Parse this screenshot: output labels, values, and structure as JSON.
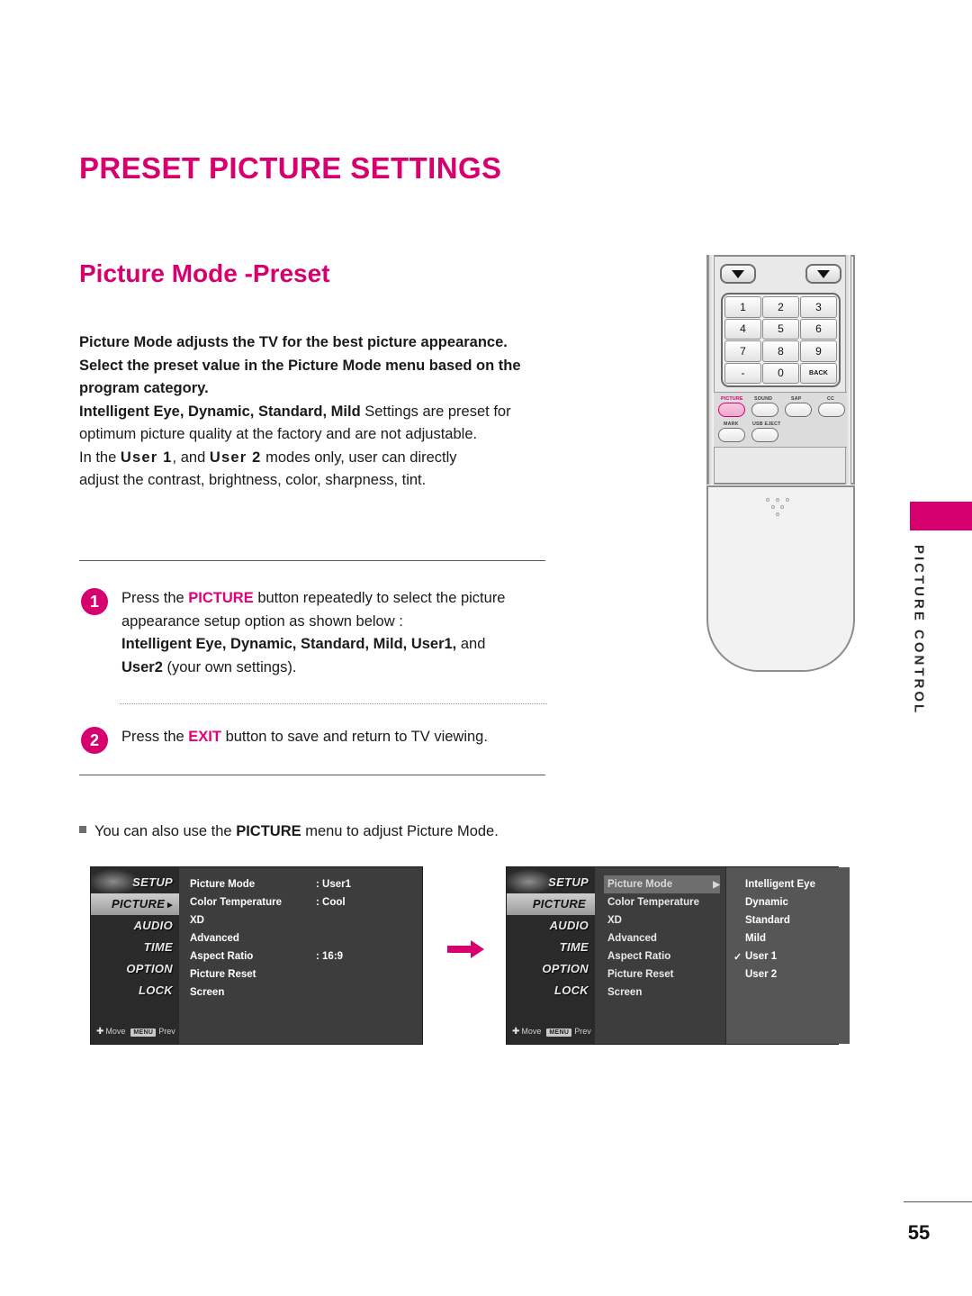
{
  "page": {
    "title": "PRESET PICTURE SETTINGS",
    "section_title": "Picture Mode -Preset",
    "number": "55"
  },
  "side_tab": {
    "label": "PICTURE CONTROL",
    "accent_color": "#d6006e"
  },
  "intro": {
    "line1": "Picture Mode adjusts the TV for the best picture appearance.",
    "line2": "Select the preset value in the Picture Mode menu based on the",
    "line3": "program category.",
    "line4_bold": "Intelligent Eye, Dynamic, Standard, Mild",
    "line4_rest": "Settings are preset for",
    "line5": "optimum picture quality at the factory and are not adjustable.",
    "line6_pre": "In the",
    "line6_user1": "User 1",
    "line6_mid": ", and",
    "line6_user2": "User 2",
    "line6_rest": "modes only, user can directly",
    "line7": "adjust the contrast, brightness, color, sharpness, tint."
  },
  "steps": [
    {
      "number": "1",
      "text_pre": "Press the",
      "keyword": "PICTURE",
      "text_post": "button repeatedly to select the picture",
      "line2": "appearance setup option as shown below :",
      "line3_bold": "Intelligent Eye, Dynamic, Standard, Mild, User1,",
      "line3_rest": "and",
      "line4_bold": "User2",
      "line4_rest": "(your own settings)."
    },
    {
      "number": "2",
      "text_pre": "Press the",
      "keyword": "EXIT",
      "text_post": "button to save and return to TV viewing."
    }
  ],
  "note": {
    "text_pre": "You can also use the",
    "keyword": "PICTURE",
    "text_post": "menu to adjust Picture Mode."
  },
  "osd": {
    "nav": [
      "SETUP",
      "PICTURE",
      "AUDIO",
      "TIME",
      "OPTION",
      "LOCK"
    ],
    "active_nav": "PICTURE",
    "footer": {
      "move": "Move",
      "prev": "Prev",
      "menu_chip": "MENU"
    },
    "menu_rows": [
      {
        "label": "Picture Mode",
        "value": ": User1"
      },
      {
        "label": "Color Temperature",
        "value": ": Cool"
      },
      {
        "label": "XD",
        "value": ""
      },
      {
        "label": "Advanced",
        "value": ""
      },
      {
        "label": "Aspect Ratio",
        "value": ": 16:9"
      },
      {
        "label": "Picture Reset",
        "value": ""
      },
      {
        "label": "Screen",
        "value": ""
      }
    ],
    "submenu_rows": [
      {
        "label": "Intelligent Eye",
        "checked": false
      },
      {
        "label": "Dynamic",
        "checked": false
      },
      {
        "label": "Standard",
        "checked": false
      },
      {
        "label": "Mild",
        "checked": false
      },
      {
        "label": "User 1",
        "checked": true
      },
      {
        "label": "User 2",
        "checked": false
      }
    ],
    "selected_row": "Picture Mode",
    "check_glyph": "✓",
    "submenu_arrow": "▶",
    "transition_arrow": "arrow-right-icon"
  },
  "remote": {
    "keypad": [
      "1",
      "2",
      "3",
      "4",
      "5",
      "6",
      "7",
      "8",
      "9",
      "-",
      "0",
      "BACK"
    ],
    "function_buttons": [
      {
        "label": "PICTURE",
        "highlighted": true
      },
      {
        "label": "SOUND",
        "highlighted": false
      },
      {
        "label": "SAP",
        "highlighted": false
      },
      {
        "label": "CC",
        "highlighted": false
      },
      {
        "label": "MARK",
        "highlighted": false
      },
      {
        "label": "USB EJECT",
        "highlighted": false
      }
    ]
  }
}
